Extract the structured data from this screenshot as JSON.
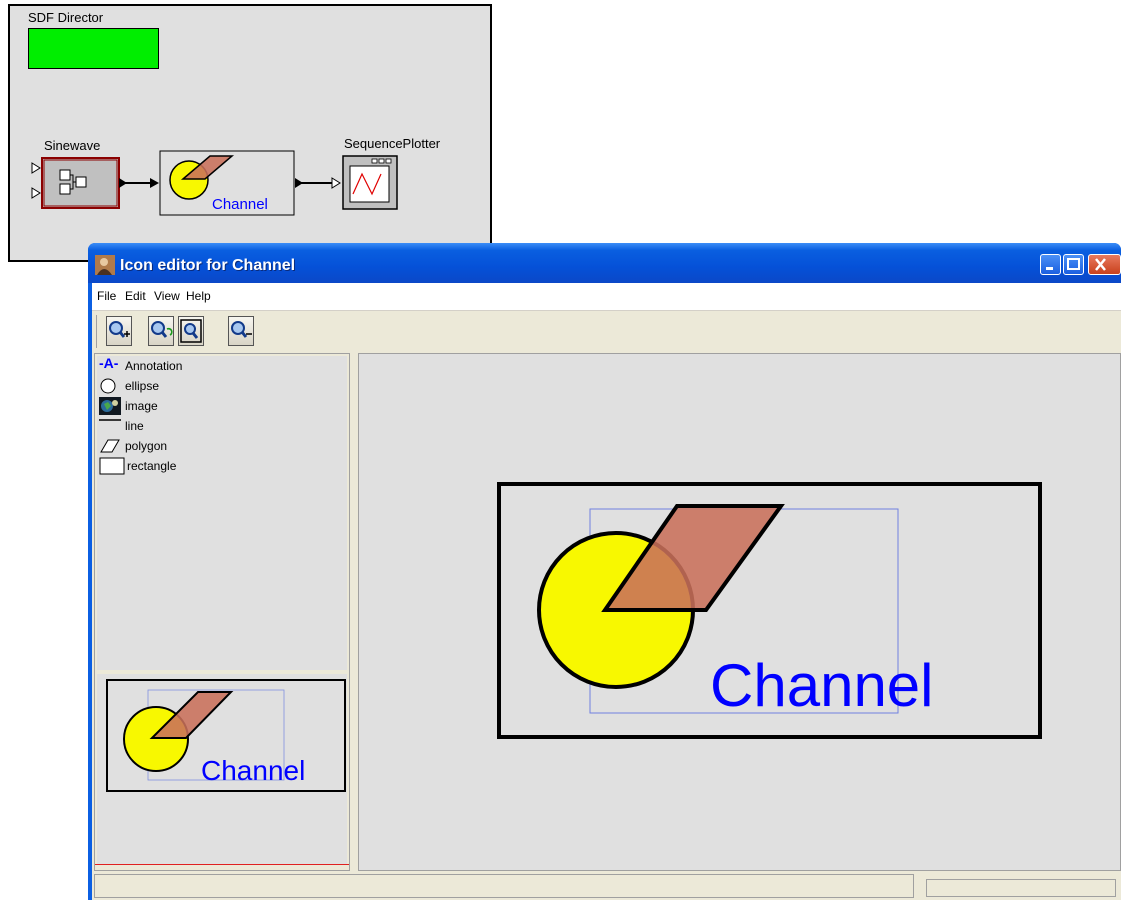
{
  "model": {
    "director_label": "SDF Director",
    "sinewave_label": "Sinewave",
    "plotter_label": "SequencePlotter",
    "channel_icon_text": "Channel",
    "director_color": "#00ee00"
  },
  "window": {
    "title": "Icon editor for Channel",
    "app_icon": "ptolemy-icon",
    "controls": [
      "minimize-icon",
      "maximize-icon",
      "close-icon"
    ]
  },
  "menu": {
    "file": "File",
    "edit": "Edit",
    "view": "View",
    "help": "Help"
  },
  "toolbar": {
    "buttons": [
      "zoom-in-icon",
      "zoom-reset-icon",
      "zoom-fit-icon",
      "zoom-out-icon"
    ]
  },
  "library": {
    "items": [
      {
        "label": "Annotation",
        "icon": "annotation-icon"
      },
      {
        "label": "ellipse",
        "icon": "ellipse-icon"
      },
      {
        "label": "image",
        "icon": "image-icon"
      },
      {
        "label": "line",
        "icon": "line-icon"
      },
      {
        "label": "polygon",
        "icon": "polygon-icon"
      },
      {
        "label": "rectangle",
        "icon": "rectangle-icon"
      }
    ],
    "annotation_glyph": "-A-"
  },
  "icon": {
    "text": "Channel",
    "text_color": "#0000ff",
    "circle_color": "#f8f800",
    "polygon_color": "#c8705a"
  }
}
